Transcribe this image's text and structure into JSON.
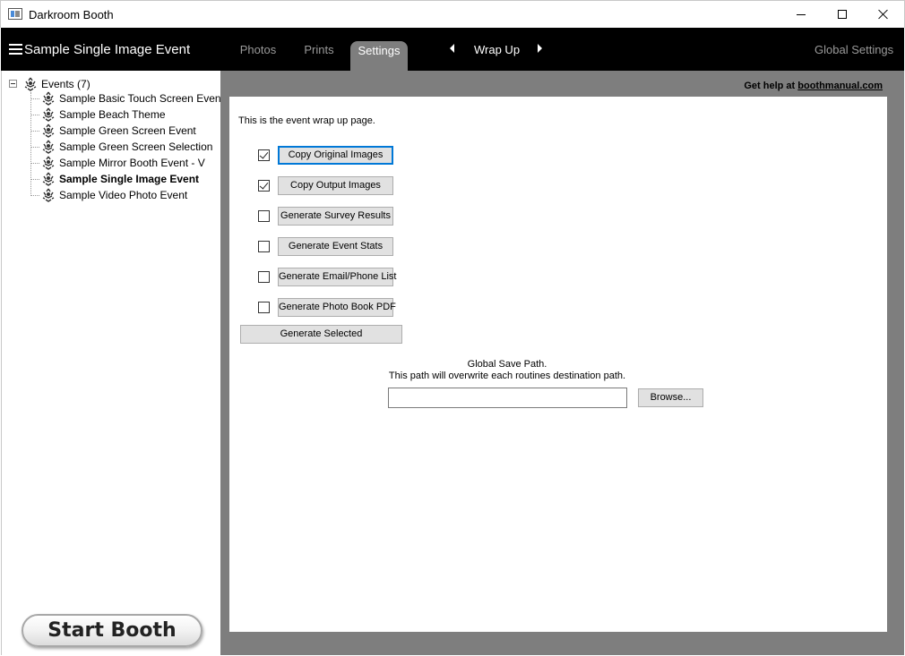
{
  "window": {
    "title": "Darkroom Booth"
  },
  "header": {
    "event_title": "Sample Single Image Event",
    "tabs": [
      {
        "label": "Photos"
      },
      {
        "label": "Prints"
      },
      {
        "label": "Settings"
      }
    ],
    "section": "Wrap Up",
    "global_settings": "Global Settings"
  },
  "sidebar": {
    "root": "Events (7)",
    "events": [
      {
        "label": "Sample Basic Touch Screen Event"
      },
      {
        "label": "Sample Beach Theme"
      },
      {
        "label": "Sample Green Screen Event"
      },
      {
        "label": "Sample Green Screen Selection"
      },
      {
        "label": "Sample Mirror Booth Event - V"
      },
      {
        "label": "Sample Single Image Event",
        "selected": true
      },
      {
        "label": "Sample Video Photo Event"
      }
    ],
    "start_booth": "Start Booth"
  },
  "main": {
    "help_prefix": "Get help at",
    "help_link": "boothmanual.com",
    "intro": "This is the event wrap up page.",
    "actions": [
      {
        "label": "Copy Original Images",
        "checked": true
      },
      {
        "label": "Copy Output Images",
        "checked": true
      },
      {
        "label": "Generate Survey Results",
        "checked": false
      },
      {
        "label": "Generate Event Stats",
        "checked": false
      },
      {
        "label": "Generate Email/Phone List",
        "checked": false
      },
      {
        "label": "Generate Photo Book PDF",
        "checked": false
      }
    ],
    "generate_selected": "Generate Selected",
    "save_path_title": "Global Save Path.",
    "save_path_desc": "This path will overwrite each routines destination path.",
    "save_path_value": "",
    "browse": "Browse..."
  },
  "colors": {
    "header_bg": "#000000",
    "active_tab": "#7e7e7e",
    "focus_border": "#0078d7"
  }
}
